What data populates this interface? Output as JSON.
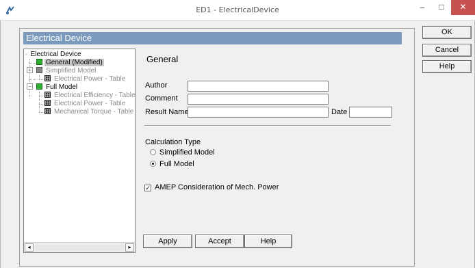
{
  "window": {
    "title": "ED1 - ElectricalDevice",
    "controls": {
      "minimize": "–",
      "maximize": "□",
      "close": "✕"
    }
  },
  "panel": {
    "header": "Electrical Device"
  },
  "tree": {
    "root": "Electrical Device",
    "items": [
      {
        "label": "General (Modified)",
        "icon": "green-square-icon",
        "state": "selected"
      },
      {
        "label": "Simplified Model",
        "icon": "model-icon",
        "state": "disabled"
      },
      {
        "label": "Electrical Power - Table",
        "icon": "table-icon",
        "state": "disabled"
      },
      {
        "label": "Full Model",
        "icon": "green-square-icon",
        "state": "normal"
      },
      {
        "label": "Electrical Efficiency - Table",
        "icon": "table-icon",
        "state": "disabled"
      },
      {
        "label": "Electrical Power - Table",
        "icon": "table-icon",
        "state": "disabled"
      },
      {
        "label": "Mechanical Torque - Table",
        "icon": "table-icon",
        "state": "disabled"
      }
    ],
    "scroll_left": "◂",
    "scroll_right": "▸"
  },
  "general": {
    "title": "General",
    "author_label": "Author",
    "author_value": "",
    "comment_label": "Comment",
    "comment_value": "",
    "result_name_label": "Result Name",
    "result_name_value": "",
    "date_label": "Date",
    "date_value": ""
  },
  "calculation": {
    "title": "Calculation Type",
    "options": [
      {
        "label": "Simplified Model",
        "selected": false
      },
      {
        "label": "Full Model",
        "selected": true
      }
    ]
  },
  "amep": {
    "label": "AMEP Consideration of Mech. Power",
    "checked": true,
    "mark": "✓"
  },
  "buttons": {
    "apply": "Apply",
    "accept": "Accept",
    "help": "Help"
  },
  "side_buttons": {
    "ok": "OK",
    "cancel": "Cancel",
    "help": "Help"
  },
  "colors": {
    "header_bg": "#7a9bbd",
    "close_button": "#c75050",
    "tree_icon_green": "#2fae2f"
  }
}
